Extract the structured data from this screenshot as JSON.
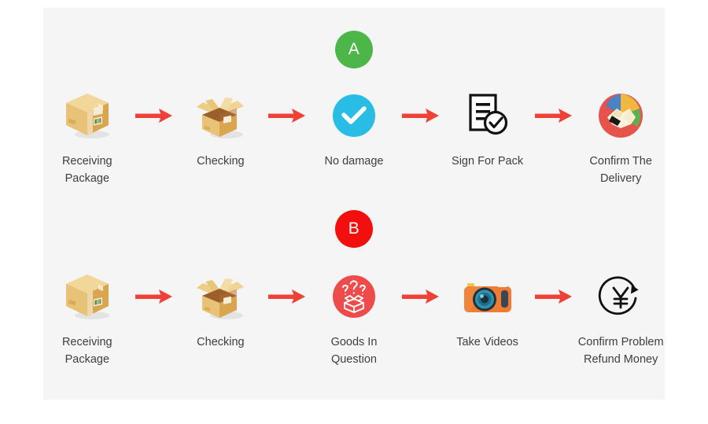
{
  "panel": {
    "background_color": "#f5f5f5",
    "page_background_color": "#ffffff"
  },
  "colors": {
    "badge_a": "#4cb648",
    "badge_b": "#f40f0f",
    "arrow": "#ef4136",
    "check_circle": "#29bde5",
    "question_circle": "#ef4b4b",
    "box_body": "#e7b860",
    "box_top": "#f0d08a",
    "camera_body": "#ef7c32",
    "camera_lens": "#1c6c86",
    "handshake_red": "#e5534b",
    "label_text": "#3e3e3e"
  },
  "sections": [
    {
      "badge": "A",
      "badge_name": "badge-a",
      "steps": [
        {
          "label": "Receiving Package",
          "icon": "closed-box-icon"
        },
        {
          "label": "Checking",
          "icon": "open-box-icon"
        },
        {
          "label": "No damage",
          "icon": "check-circle-icon"
        },
        {
          "label": "Sign For Pack",
          "icon": "signed-document-icon"
        },
        {
          "label": "Confirm The Delivery",
          "icon": "handshake-icon"
        }
      ]
    },
    {
      "badge": "B",
      "badge_name": "badge-b",
      "steps": [
        {
          "label": "Receiving Package",
          "icon": "closed-box-icon"
        },
        {
          "label": "Checking",
          "icon": "open-box-icon"
        },
        {
          "label": "Goods In Question",
          "icon": "question-box-icon"
        },
        {
          "label": "Take Videos",
          "icon": "camera-icon"
        },
        {
          "label": "Confirm Problem\nRefund Money",
          "icon": "refund-yen-icon"
        }
      ]
    }
  ]
}
